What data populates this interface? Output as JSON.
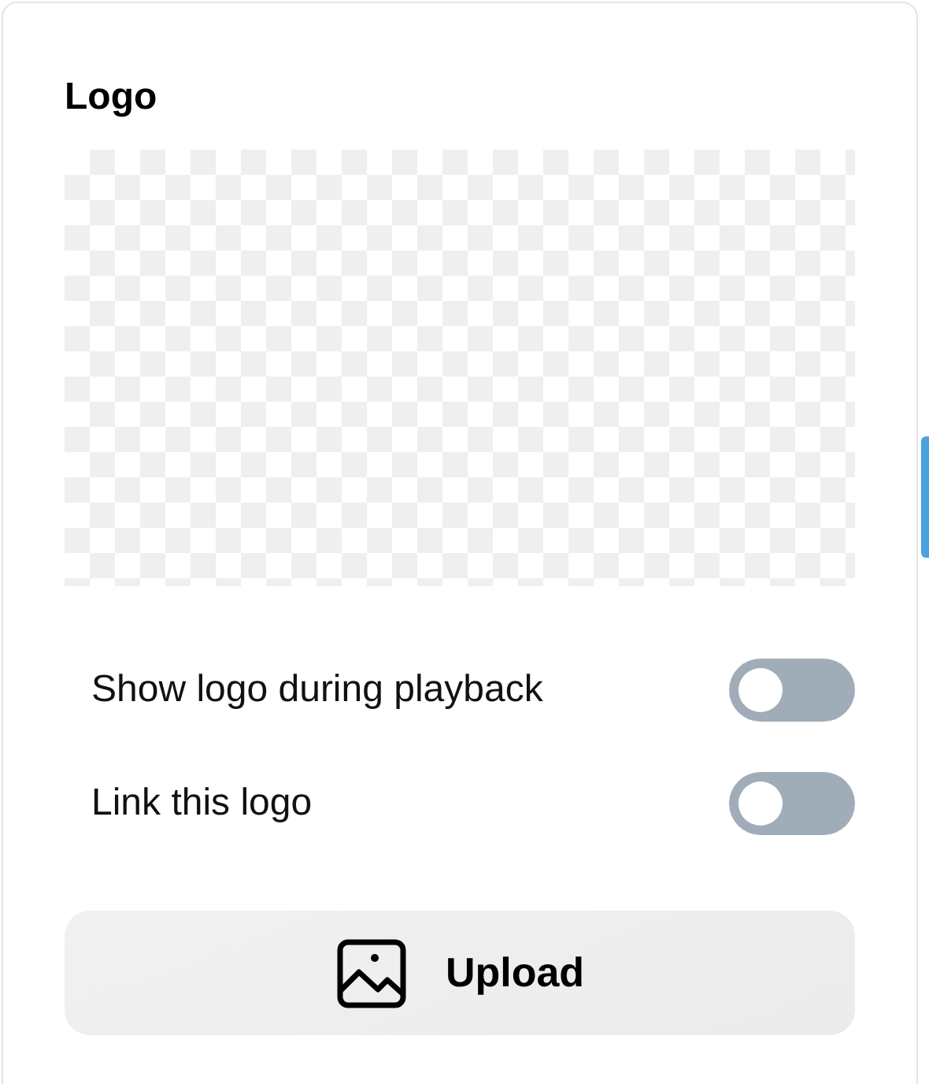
{
  "section": {
    "title": "Logo"
  },
  "toggles": [
    {
      "label": "Show logo during playback",
      "on": false
    },
    {
      "label": "Link this logo",
      "on": false
    }
  ],
  "upload_button": {
    "label": "Upload"
  }
}
